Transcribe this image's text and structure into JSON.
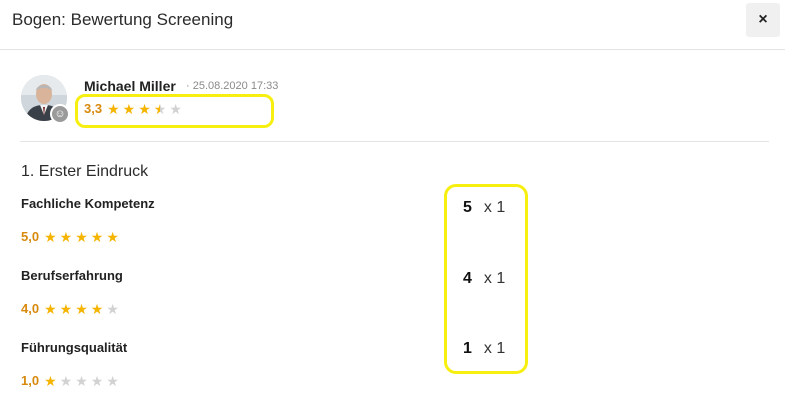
{
  "dialog": {
    "title": "Bogen: Bewertung Screening",
    "close_label": "×"
  },
  "author": {
    "name": "Michael Miller",
    "date": "· 25.08.2020 17:33",
    "badge_icon": "smiley-icon"
  },
  "overall": {
    "value": "3,3",
    "rating": 3.3,
    "max": 5
  },
  "section": {
    "title": "1. Erster Eindruck"
  },
  "criteria": [
    {
      "label": "Fachliche Kompetenz",
      "value": "5,0",
      "rating": 5,
      "score": "5",
      "multiplier": "x 1"
    },
    {
      "label": "Berufserfahrung",
      "value": "4,0",
      "rating": 4,
      "score": "4",
      "multiplier": "x 1"
    },
    {
      "label": "Führungsqualität",
      "value": "1,0",
      "rating": 1,
      "score": "1",
      "multiplier": "x 1"
    }
  ],
  "colors": {
    "star": "#f5b400",
    "rating_value": "#d88a0e",
    "highlight": "#f6ef10",
    "star_empty": "#d2d2d2"
  }
}
